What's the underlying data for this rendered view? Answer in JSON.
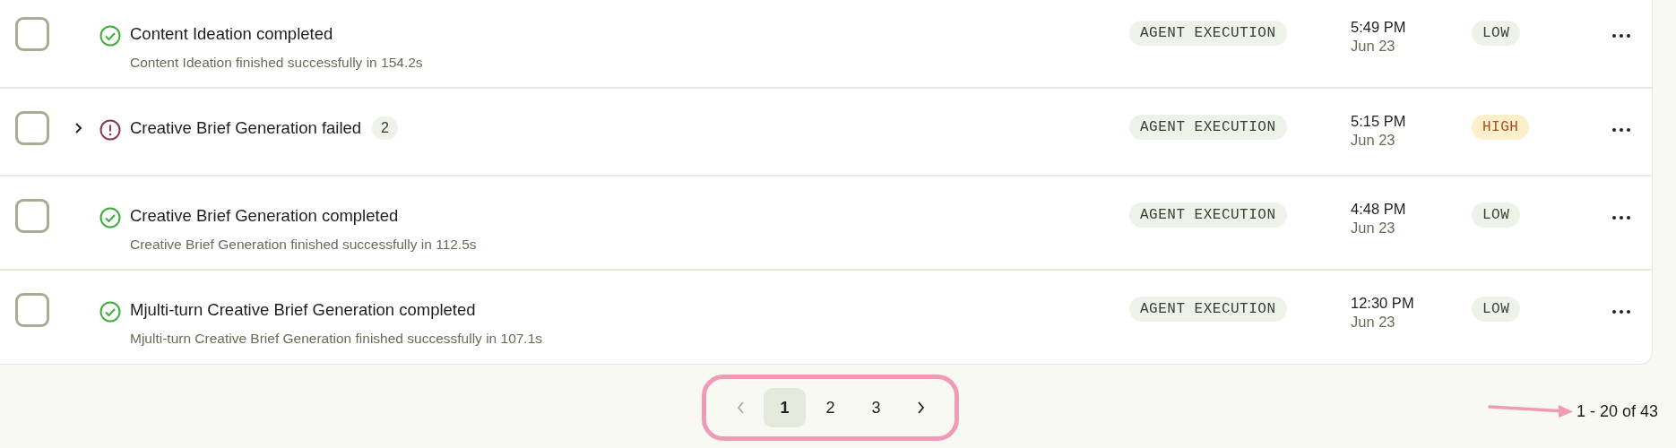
{
  "rows": [
    {
      "checked": false,
      "failed": false,
      "expandable": false,
      "title": "Content Ideation completed",
      "subtitle": "Content Ideation finished successfully in 154.2s",
      "tag": "AGENT EXECUTION",
      "time": "5:49 PM",
      "date": "Jun 23",
      "priority": {
        "label": "LOW",
        "color": "#eef3ea"
      }
    },
    {
      "checked": false,
      "failed": true,
      "expandable": true,
      "expanded": false,
      "title": "Creative Brief Generation failed",
      "count": "2",
      "tag": "AGENT EXECUTION",
      "time": "5:15 PM",
      "date": "Jun 23",
      "priority": {
        "label": "HIGH",
        "color": "#fcefcb"
      }
    },
    {
      "checked": false,
      "failed": false,
      "expandable": false,
      "title": "Creative Brief Generation completed",
      "subtitle": "Creative Brief Generation finished successfully in 112.5s",
      "tag": "AGENT EXECUTION",
      "time": "4:48 PM",
      "date": "Jun 23",
      "priority": {
        "label": "LOW",
        "color": "#eef3ea"
      }
    },
    {
      "checked": false,
      "failed": false,
      "expandable": false,
      "title": "Mjulti-turn Creative Brief Generation completed",
      "subtitle": "Mjulti-turn Creative Brief Generation finished successfully in 107.1s",
      "tag": "AGENT EXECUTION",
      "time": "12:30 PM",
      "date": "Jun 23",
      "priority": {
        "label": "LOW",
        "color": "#eef3ea"
      }
    }
  ],
  "pagination": {
    "prev": {
      "disabled": true
    },
    "pages": [
      {
        "label": "1",
        "selected": true
      },
      {
        "label": "2",
        "selected": false
      },
      {
        "label": "3",
        "selected": false
      }
    ],
    "next": {
      "disabled": false
    },
    "range": "1 - 20 of 43"
  },
  "annotations": {
    "highlight_box": true,
    "pointer_arrow": true
  }
}
